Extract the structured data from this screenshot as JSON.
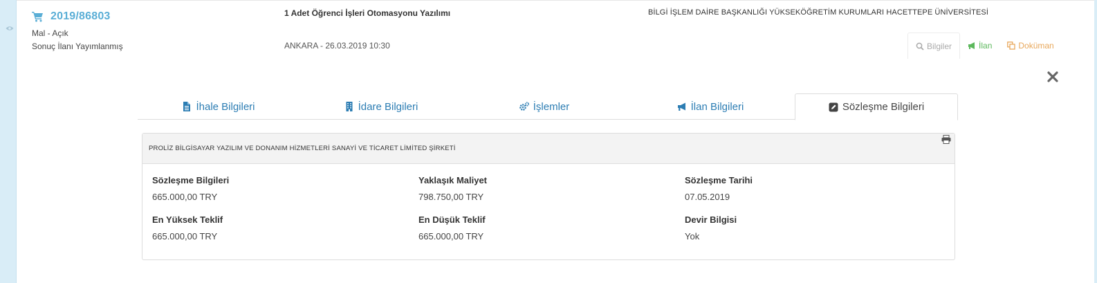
{
  "header": {
    "ihale_no": "2019/86803",
    "type": "Mal - Açık",
    "status": "Sonuç İlanı Yayımlanmış",
    "title": "1 Adet Öğrenci İşleri Otomasyonu Yazılımı",
    "location_date": "ANKARA - 26.03.2019 10:30",
    "institution": "BİLGİ İŞLEM DAİRE BAŞKANLIĞI YÜKSEKÖĞRETİM KURUMLARI HACETTEPE ÜNİVERSİTESİ"
  },
  "actions": {
    "bilgiler": "Bilgiler",
    "ilan": "İlan",
    "dokuman": "Doküman"
  },
  "tabs": [
    {
      "label": "İhale Bilgileri",
      "icon": "file-text-icon"
    },
    {
      "label": "İdare Bilgileri",
      "icon": "building-icon"
    },
    {
      "label": "İşlemler",
      "icon": "gears-icon"
    },
    {
      "label": "İlan Bilgileri",
      "icon": "bullhorn-icon"
    },
    {
      "label": "Sözleşme Bilgileri",
      "icon": "edit-icon",
      "active": true
    }
  ],
  "contract": {
    "company": "PROLİZ BİLGİSAYAR YAZILIM VE DONANIM HİZMETLERİ SANAYİ VE TİCARET LİMİTED ŞİRKETİ",
    "fields": [
      {
        "label": "Sözleşme Bilgileri",
        "value": "665.000,00 TRY"
      },
      {
        "label": "Yaklaşık Maliyet",
        "value": "798.750,00 TRY"
      },
      {
        "label": "Sözleşme Tarihi",
        "value": "07.05.2019"
      },
      {
        "label": "En Yüksek Teklif",
        "value": "665.000,00 TRY"
      },
      {
        "label": "En Düşük Teklif",
        "value": "665.000,00 TRY"
      },
      {
        "label": "Devir Bilgisi",
        "value": "Yok"
      }
    ]
  },
  "colors": {
    "link_blue": "#2c7db3",
    "id_blue": "#5aaed6",
    "ilan_green": "#5cb85c",
    "dokuman_orange": "#e8a75a",
    "side_strip": "#d9edf7"
  }
}
